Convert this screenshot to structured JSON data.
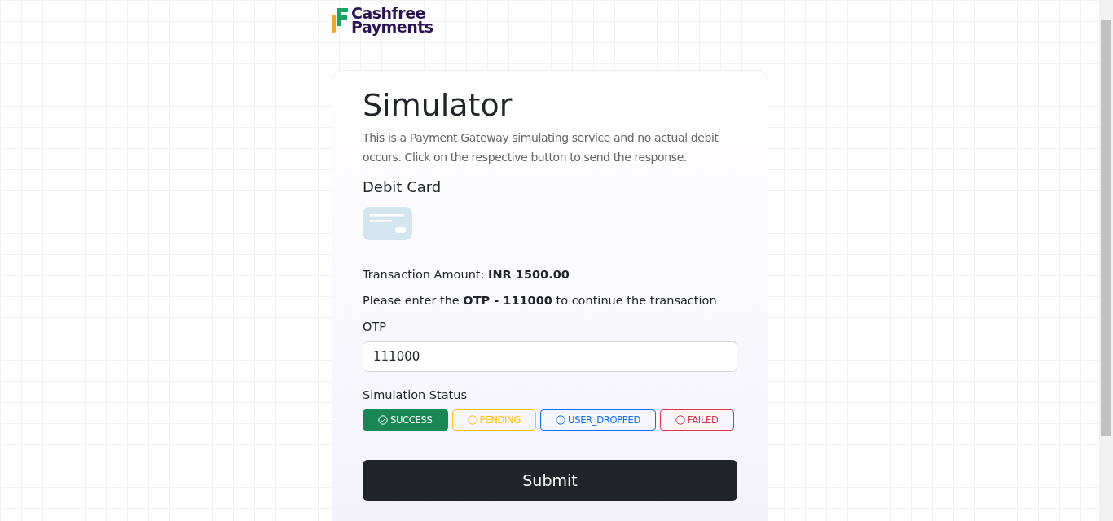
{
  "brand": {
    "lines": [
      "Cashfree",
      "Payments"
    ]
  },
  "card": {
    "title": "Simulator",
    "description": "This is a Payment Gateway simulating service and no actual debit occurs. Click on the respective button to send the response.",
    "method": "Debit Card",
    "amount": "Transaction Amount: **INR 1500.00**",
    "instruction": "Please enter the **OTP - 111000** to continue the transaction",
    "otp": {
      "label": "OTP",
      "value": "111000"
    },
    "status": {
      "label": "Simulation Status",
      "options": [
        {
          "label": "SUCCESS",
          "selected": true,
          "color": "#198754"
        },
        {
          "label": "PENDING",
          "selected": false,
          "color": "#ffc107"
        },
        {
          "label": "USER_DROPPED",
          "selected": false,
          "color": "#0d6efd"
        },
        {
          "label": "FAILED",
          "selected": false,
          "color": "#dc3545"
        }
      ]
    },
    "submit": "Submit"
  }
}
